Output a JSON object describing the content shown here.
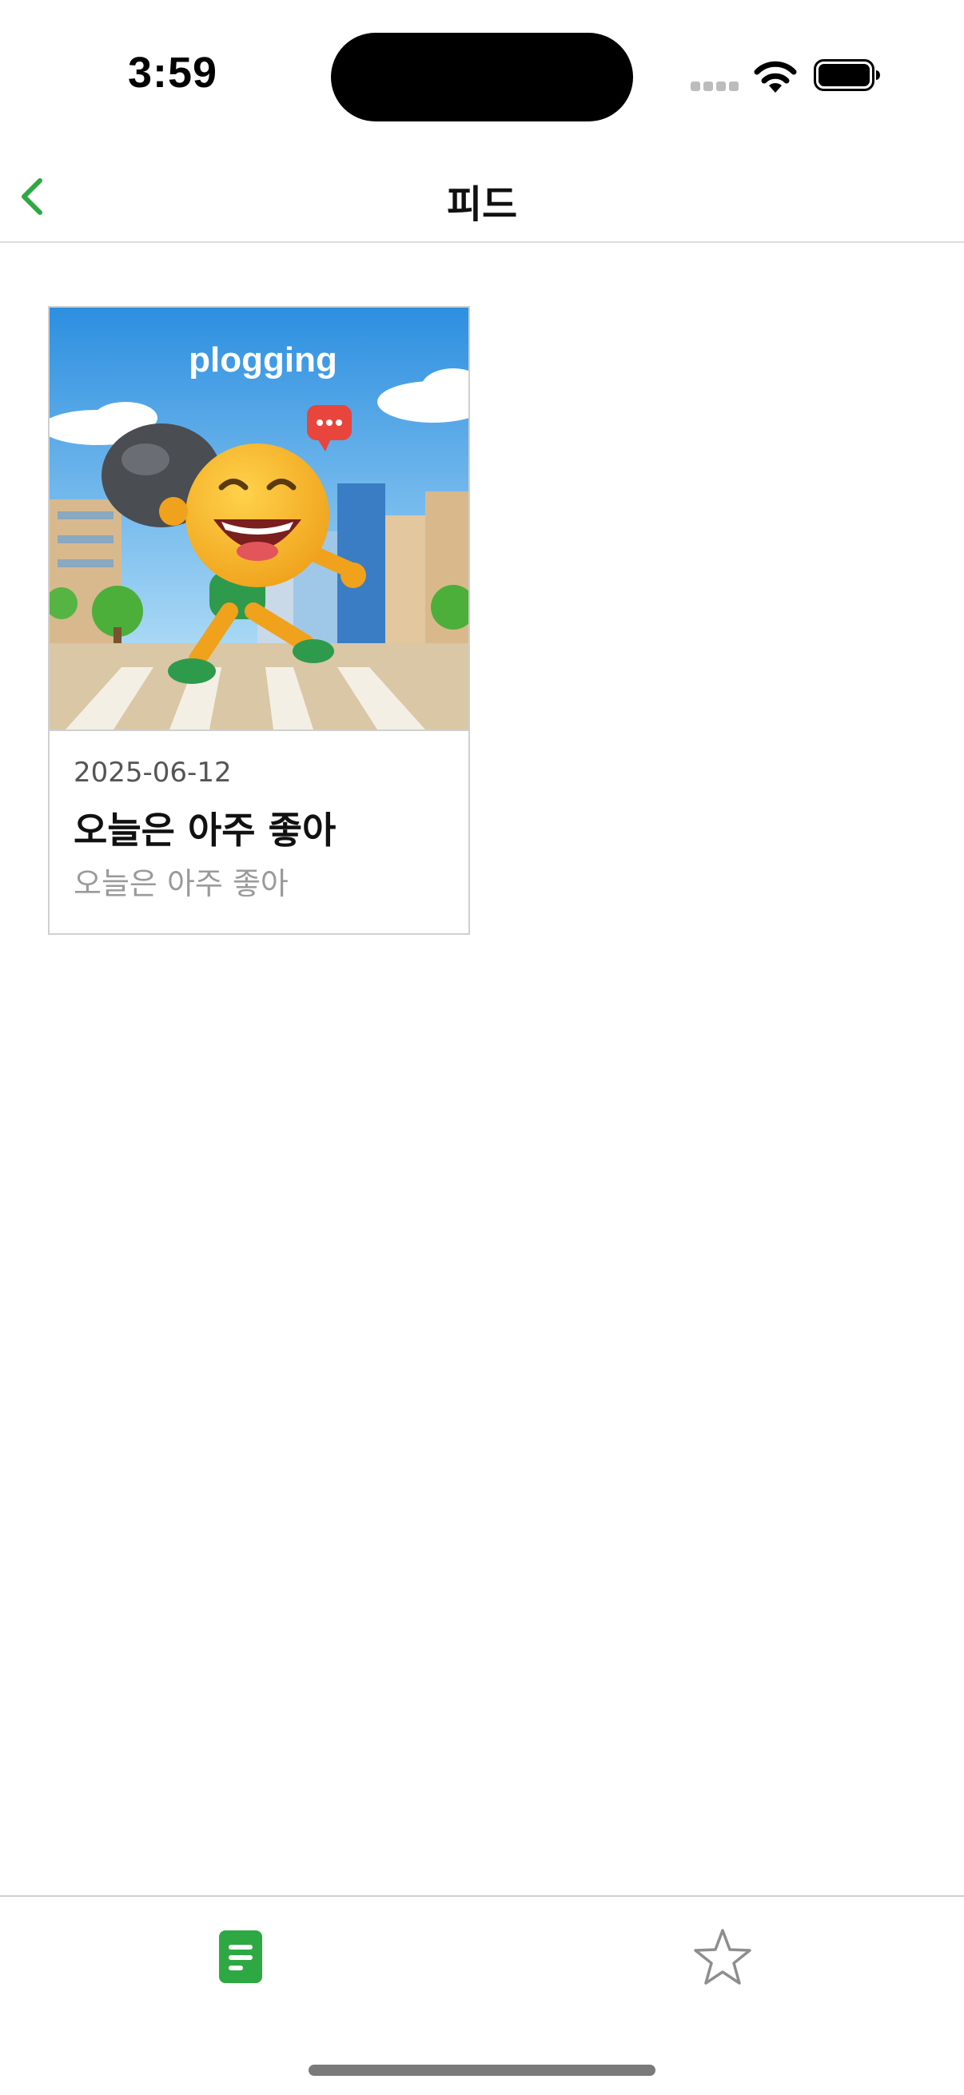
{
  "status_bar": {
    "time": "3:59",
    "icons": [
      "cellular-signal-icon",
      "wifi-icon",
      "battery-icon"
    ]
  },
  "nav": {
    "title": "피드",
    "back_icon": "chevron-left-icon",
    "accent_color": "#2ea843"
  },
  "feed": {
    "items": [
      {
        "image_caption": "plogging",
        "date": "2025-06-12",
        "title": "오늘은 아주 좋아",
        "body": "오늘은 아주 좋아"
      }
    ]
  },
  "tab_bar": {
    "tabs": [
      {
        "icon": "document-icon",
        "selected": true,
        "color": "#2ea843"
      },
      {
        "icon": "star-icon",
        "selected": false,
        "color": "#8e8e8e"
      }
    ]
  }
}
